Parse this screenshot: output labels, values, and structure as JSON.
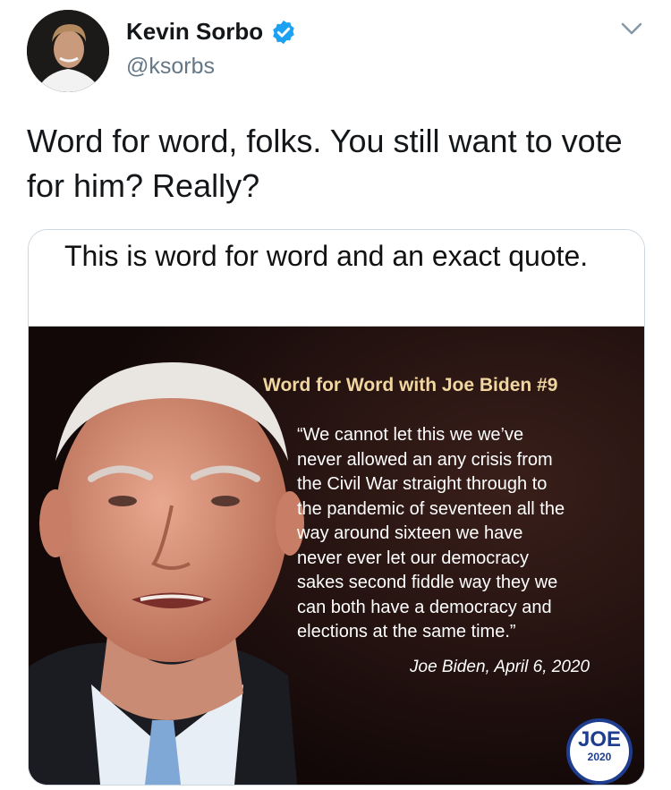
{
  "header": {
    "display_name": "Kevin Sorbo",
    "handle": "@ksorbs",
    "verified_icon": "verified-badge-icon",
    "menu_icon": "chevron-down-icon"
  },
  "tweet": {
    "text": "Word for word, folks.  You still want to vote for him? Really?"
  },
  "quoted_image": {
    "header_text": "This is word for word and an exact quote.",
    "meme_title": "Word for Word with Joe Biden #9",
    "meme_quote": "“We cannot let this we we’ve\nnever allowed an any crisis from\nthe Civil War straight through to\nthe pandemic of seventeen all the\nway around sixteen we have\nnever ever let our democracy\nsakes second fiddle way they we\ncan both have a democracy and\nelections at the same time.”",
    "meme_attribution": "Joe Biden, April 6, 2020",
    "badge_top": "JOE",
    "badge_bottom": "2020"
  },
  "colors": {
    "verified": "#1da1f2",
    "handle": "#657786",
    "meme_title": "#f1d6a0",
    "badge": "#1f3d8f"
  }
}
